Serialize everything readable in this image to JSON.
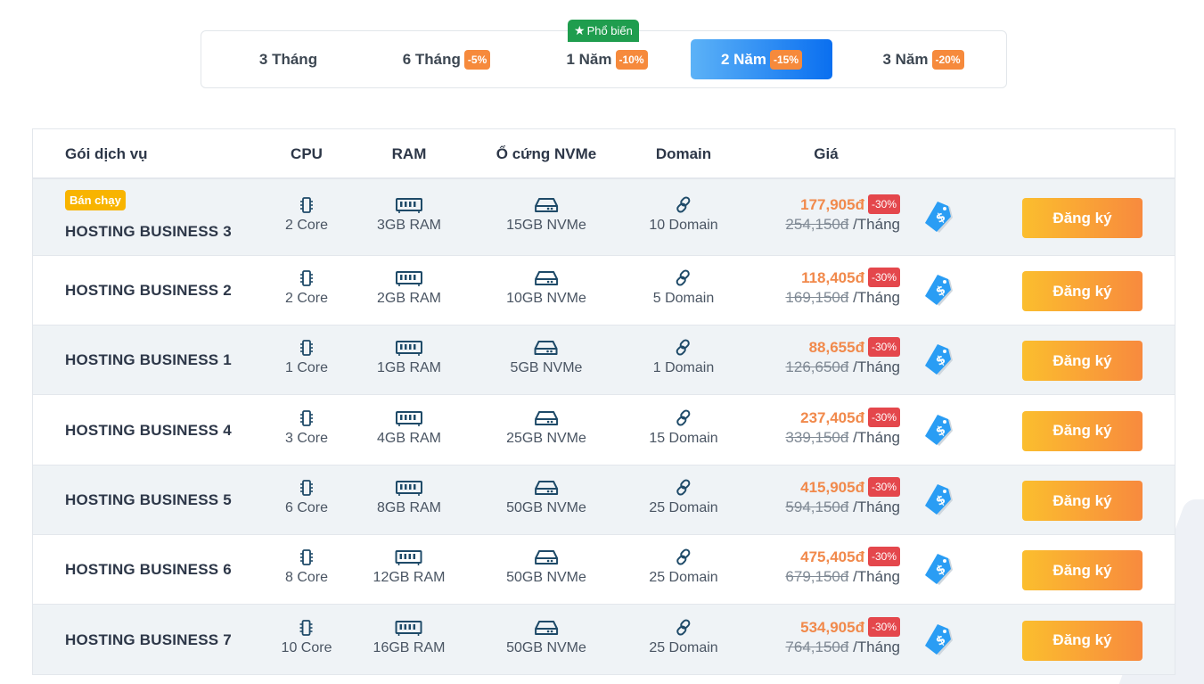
{
  "tabs": [
    {
      "label": "3 Tháng",
      "discount": ""
    },
    {
      "label": "6 Tháng",
      "discount": "-5%"
    },
    {
      "label": "1 Năm",
      "discount": "-10%"
    },
    {
      "label": "2 Năm",
      "discount": "-15%"
    },
    {
      "label": "3 Năm",
      "discount": "-20%"
    }
  ],
  "active_tab": "2 Năm",
  "popular_badge": "Phổ biến",
  "headers": {
    "package": "Gói dịch vụ",
    "cpu": "CPU",
    "ram": "RAM",
    "disk": "Ổ cứng NVMe",
    "domain": "Domain",
    "price": "Giá"
  },
  "hot_badge": "Bán chạy",
  "per_month": "/Tháng",
  "discount_label": "-30%",
  "signup_label": "Đăng ký",
  "rows": [
    {
      "name": "HOSTING BUSINESS 3",
      "cpu": "2 Core",
      "ram": "3GB RAM",
      "disk": "15GB NVMe",
      "domain": "10 Domain",
      "price": "177,905đ",
      "old_price": "254,150đ"
    },
    {
      "name": "HOSTING BUSINESS 2",
      "cpu": "2 Core",
      "ram": "2GB RAM",
      "disk": "10GB NVMe",
      "domain": "5 Domain",
      "price": "118,405đ",
      "old_price": "169,150đ"
    },
    {
      "name": "HOSTING BUSINESS 1",
      "cpu": "1 Core",
      "ram": "1GB RAM",
      "disk": "5GB NVMe",
      "domain": "1 Domain",
      "price": "88,655đ",
      "old_price": "126,650đ"
    },
    {
      "name": "HOSTING BUSINESS 4",
      "cpu": "3 Core",
      "ram": "4GB RAM",
      "disk": "25GB NVMe",
      "domain": "15 Domain",
      "price": "237,405đ",
      "old_price": "339,150đ"
    },
    {
      "name": "HOSTING BUSINESS 5",
      "cpu": "6 Core",
      "ram": "8GB RAM",
      "disk": "50GB NVMe",
      "domain": "25 Domain",
      "price": "415,905đ",
      "old_price": "594,150đ"
    },
    {
      "name": "HOSTING BUSINESS 6",
      "cpu": "8 Core",
      "ram": "12GB RAM",
      "disk": "50GB NVMe",
      "domain": "25 Domain",
      "price": "475,405đ",
      "old_price": "679,150đ"
    },
    {
      "name": "HOSTING BUSINESS 7",
      "cpu": "10 Core",
      "ram": "16GB RAM",
      "disk": "50GB NVMe",
      "domain": "25 Domain",
      "price": "534,905đ",
      "old_price": "764,150đ"
    }
  ],
  "colors": {
    "accent_blue": "#0a6ff0",
    "discount_orange": "#f68a3c",
    "price_orange": "#f1894b",
    "sale_red": "#e4474c",
    "popular_green": "#1f9d4e",
    "hot_yellow": "#f8b400"
  },
  "icons": {
    "cpu": "cpu-chip-icon",
    "ram": "memory-stick-icon",
    "disk": "hard-drive-icon",
    "domain": "link-icon",
    "tag": "price-tag-icon",
    "popular": "star-icon"
  }
}
